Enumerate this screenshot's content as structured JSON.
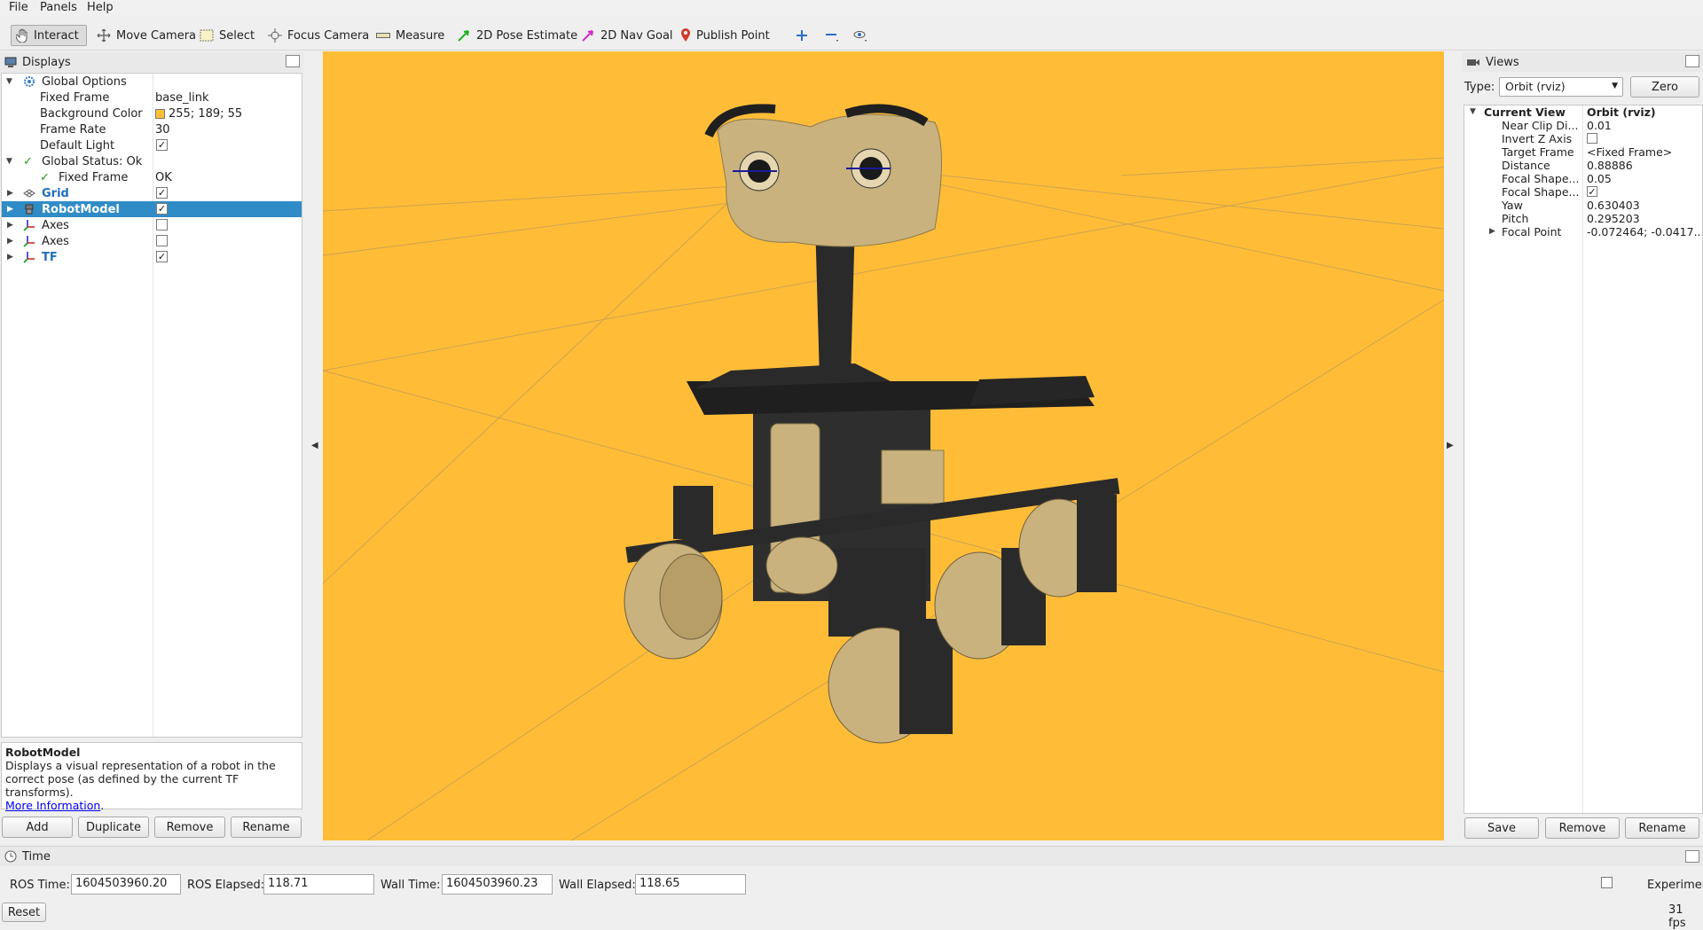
{
  "menu": [
    "File",
    "Panels",
    "Help"
  ],
  "toolbar": {
    "interact": "Interact",
    "move_camera": "Move Camera",
    "select": "Select",
    "focus_camera": "Focus Camera",
    "measure": "Measure",
    "pose_estimate": "2D Pose Estimate",
    "nav_goal": "2D Nav Goal",
    "publish_point": "Publish Point"
  },
  "displays": {
    "title": "Displays",
    "rows": {
      "global_options": "Global Options",
      "fixed_frame": "Fixed Frame",
      "fixed_frame_val": "base_link",
      "bg_color": "Background Color",
      "bg_color_val": "255; 189; 55",
      "frame_rate": "Frame Rate",
      "frame_rate_val": "30",
      "default_light": "Default Light",
      "global_status": "Global Status: Ok",
      "status_fixed_frame": "Fixed Frame",
      "status_fixed_frame_val": "OK",
      "grid": "Grid",
      "robot_model": "RobotModel",
      "axes1": "Axes",
      "axes2": "Axes",
      "tf": "TF"
    },
    "checks": {
      "default_light": true,
      "grid": true,
      "robot_model": true,
      "axes1": false,
      "axes2": false,
      "tf": true
    },
    "description": {
      "title": "RobotModel",
      "body": "Displays a visual representation of a robot in the correct pose (as defined by the current TF transforms).",
      "link": "More Information",
      "link_suffix": "."
    },
    "buttons": {
      "add": "Add",
      "duplicate": "Duplicate",
      "remove": "Remove",
      "rename": "Rename"
    }
  },
  "views": {
    "title": "Views",
    "type_label": "Type:",
    "type_value": "Orbit (rviz)",
    "zero": "Zero",
    "current_view": "Current View",
    "current_view_val": "Orbit (rviz)",
    "props": [
      {
        "key": "Near Clip Di...",
        "val": "0.01"
      },
      {
        "key": "Invert Z Axis",
        "val": ""
      },
      {
        "key": "Target Frame",
        "val": "<Fixed Frame>"
      },
      {
        "key": "Distance",
        "val": "0.88886"
      },
      {
        "key": "Focal Shape...",
        "val": "0.05"
      },
      {
        "key": "Focal Shape...",
        "val": ""
      },
      {
        "key": "Yaw",
        "val": "0.630403"
      },
      {
        "key": "Pitch",
        "val": "0.295203"
      },
      {
        "key": "Focal Point",
        "val": "-0.072464; -0.0417..."
      }
    ],
    "invert_z_checked": false,
    "focal_shape_checked": true,
    "buttons": {
      "save": "Save",
      "remove": "Remove",
      "rename": "Rename"
    }
  },
  "time": {
    "title": "Time",
    "ros_time_label": "ROS Time:",
    "ros_time": "1604503960.20",
    "ros_elapsed_label": "ROS Elapsed:",
    "ros_elapsed": "118.71",
    "wall_time_label": "Wall Time:",
    "wall_time": "1604503960.23",
    "wall_elapsed_label": "Wall Elapsed:",
    "wall_elapsed": "118.65",
    "experimental": "Experimental",
    "reset": "Reset",
    "fps": "31 fps"
  },
  "colors": {
    "background": "#ffbd37",
    "selection": "#308cc6"
  }
}
